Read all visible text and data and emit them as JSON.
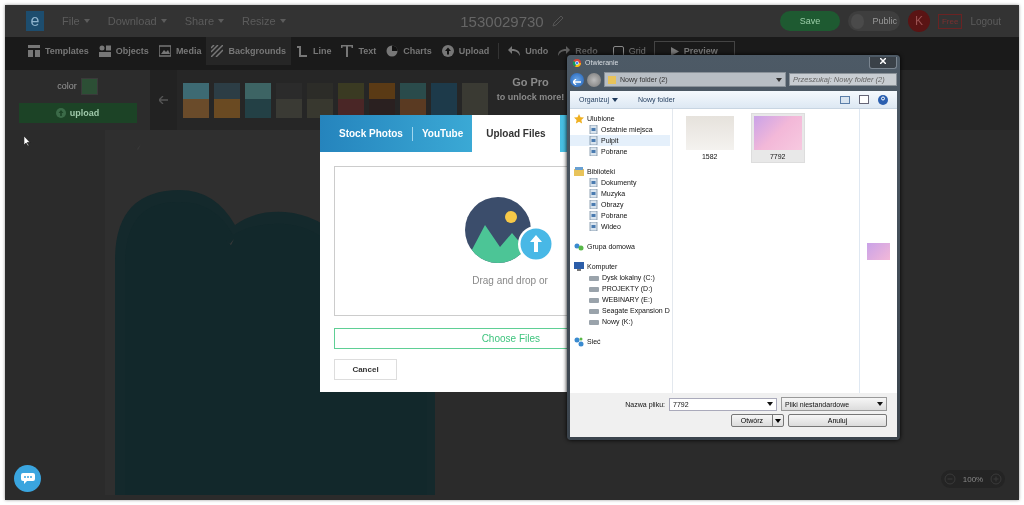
{
  "app_header": {
    "logo": "e",
    "menus": [
      {
        "label": "File"
      },
      {
        "label": "Download"
      },
      {
        "label": "Share"
      },
      {
        "label": "Resize"
      }
    ],
    "document_title": "1530029730",
    "save_button": "Save",
    "public_toggle": {
      "label": "Public",
      "on": false
    },
    "avatar": "K",
    "plan_badge": "Free",
    "logout": "Logout"
  },
  "toolbar": {
    "tools": [
      {
        "label": "Templates",
        "selected": false
      },
      {
        "label": "Objects",
        "selected": false
      },
      {
        "label": "Media",
        "selected": false
      },
      {
        "label": "Backgrounds",
        "selected": true
      },
      {
        "label": "Line",
        "selected": false
      },
      {
        "label": "Text",
        "selected": false
      },
      {
        "label": "Charts",
        "selected": false
      },
      {
        "label": "Upload",
        "selected": false
      }
    ],
    "undo": "Undo",
    "redo": "Redo",
    "grid": {
      "label": "Grid",
      "checked": false
    },
    "preview": "Preview"
  },
  "backgrounds_panel": {
    "color_label": "color",
    "upload_button": "upload",
    "go_pro": {
      "title": "Go Pro",
      "subtitle": "to unlock more!"
    }
  },
  "upload_modal": {
    "tabs": [
      {
        "label": "Stock Photos",
        "selected": false
      },
      {
        "label": "YouTube",
        "selected": false
      },
      {
        "label": "Upload Files",
        "selected": true
      }
    ],
    "drop_hint": "Drag and drop or",
    "choose_button": "Choose Files",
    "cancel_button": "Cancel"
  },
  "zoom_control": {
    "value": "100%"
  },
  "file_dialog": {
    "title": "Otwieranie",
    "path": "Nowy folder (2)",
    "search_placeholder": "Przeszukaj: Nowy folder (2)",
    "commands": [
      "Organizuj",
      "Nowy folder"
    ],
    "navigation": [
      {
        "label": "Ulubione",
        "selected": false,
        "children": [
          {
            "label": "Ostatnie miejsca",
            "selected": false
          },
          {
            "label": "Pulpit",
            "selected": true
          },
          {
            "label": "Pobrane",
            "selected": false
          }
        ]
      },
      {
        "label": "Biblioteki",
        "selected": false,
        "children": [
          {
            "label": "Dokumenty",
            "selected": false
          },
          {
            "label": "Muzyka",
            "selected": false
          },
          {
            "label": "Obrazy",
            "selected": false
          },
          {
            "label": "Pobrane",
            "selected": false
          },
          {
            "label": "Wideo",
            "selected": false
          }
        ]
      },
      {
        "label": "Grupa domowa",
        "selected": false
      },
      {
        "label": "Komputer",
        "selected": false,
        "children": [
          {
            "label": "Dysk lokalny (C:)",
            "selected": false
          },
          {
            "label": "PROJEKTY (D:)",
            "selected": false
          },
          {
            "label": "WEBINARY (E:)",
            "selected": false
          },
          {
            "label": "Seagate Expansion D",
            "selected": false
          },
          {
            "label": "Nowy (K:)",
            "selected": false
          }
        ]
      },
      {
        "label": "Sieć",
        "selected": false
      }
    ],
    "files": [
      {
        "name": "1582",
        "selected": false
      },
      {
        "name": "7792",
        "selected": true
      }
    ],
    "filename_label": "Nazwa pliku:",
    "filename_value": "7792",
    "file_type": "Pliki niestandardowe",
    "open_button": "Otwórz",
    "cancel_button": "Anuluj"
  }
}
